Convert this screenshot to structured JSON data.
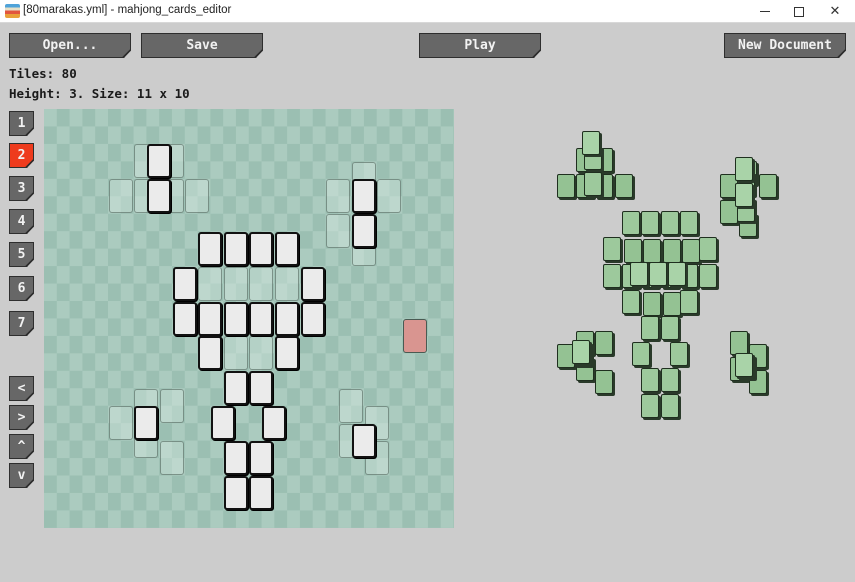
{
  "window": {
    "title": "[80marakas.yml] - mahjong_cards_editor",
    "controls": {
      "minimize": "—",
      "maximize": "☐",
      "close": "✕"
    }
  },
  "toolbar": {
    "open_label": "Open...",
    "save_label": "Save",
    "play_label": "Play",
    "new_label": "New Document"
  },
  "info": {
    "tiles": "Tiles: 80",
    "height": "Height: 3. Size: 11 x 10"
  },
  "layers": {
    "buttons": [
      "1",
      "2",
      "3",
      "4",
      "5",
      "6",
      "7"
    ],
    "active": "2"
  },
  "nav": {
    "left": "<",
    "right": ">",
    "up": "^",
    "down": "v"
  },
  "colors": {
    "active_layer": "#ee3b1d",
    "current_tile": "#ebebeb",
    "marker_tile": "#d99590",
    "preview_tile": "#94c293"
  },
  "editor": {
    "current_layer_tiles": [
      [
        8,
        2
      ],
      [
        8,
        4
      ],
      [
        24,
        4
      ],
      [
        24,
        6
      ],
      [
        12,
        7
      ],
      [
        14,
        7
      ],
      [
        16,
        7
      ],
      [
        18,
        7
      ],
      [
        10,
        9
      ],
      [
        20,
        9
      ],
      [
        10,
        11
      ],
      [
        12,
        11
      ],
      [
        14,
        11
      ],
      [
        16,
        11
      ],
      [
        18,
        11
      ],
      [
        20,
        11
      ],
      [
        12,
        13
      ],
      [
        18,
        13
      ],
      [
        14,
        15
      ],
      [
        16,
        15
      ],
      [
        13,
        17
      ],
      [
        17,
        17
      ],
      [
        7,
        17
      ],
      [
        14,
        19
      ],
      [
        16,
        19
      ],
      [
        14,
        21
      ],
      [
        16,
        21
      ],
      [
        24,
        18
      ]
    ],
    "lower_layer_tiles": [
      [
        7,
        2
      ],
      [
        9,
        2
      ],
      [
        5,
        4
      ],
      [
        7,
        4
      ],
      [
        9,
        4
      ],
      [
        11,
        4
      ],
      [
        24,
        3
      ],
      [
        22,
        4
      ],
      [
        26,
        4
      ],
      [
        22,
        6
      ],
      [
        24,
        7
      ],
      [
        12,
        9
      ],
      [
        14,
        9
      ],
      [
        16,
        9
      ],
      [
        18,
        9
      ],
      [
        14,
        13
      ],
      [
        16,
        13
      ],
      [
        7,
        16
      ],
      [
        9,
        16
      ],
      [
        5,
        17
      ],
      [
        7,
        18
      ],
      [
        9,
        19
      ],
      [
        23,
        16
      ],
      [
        25,
        17
      ],
      [
        23,
        18
      ],
      [
        25,
        19
      ]
    ],
    "marker_tile": [
      28,
      12
    ]
  },
  "preview": {
    "layer3_tiles": [
      [
        13,
        11
      ],
      [
        15,
        11
      ],
      [
        17,
        11
      ],
      [
        8,
        1
      ],
      [
        24,
        3
      ],
      [
        24,
        5
      ],
      [
        7,
        17
      ],
      [
        24,
        18
      ]
    ]
  }
}
